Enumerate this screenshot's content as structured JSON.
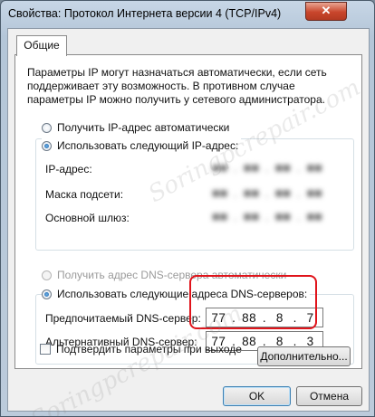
{
  "window": {
    "title": "Свойства: Протокол Интернета версии 4 (TCP/IPv4)",
    "close_label": "✕"
  },
  "tabs": [
    {
      "label": "Общие"
    }
  ],
  "description": "Параметры IP могут назначаться автоматически, если сеть поддерживает эту возможность. В противном случае параметры IP можно получить у сетевого администратора.",
  "ip_section": {
    "auto_label": "Получить IP-адрес автоматически",
    "manual_label": "Использовать следующий IP-адрес:",
    "selected": "manual",
    "fields": [
      {
        "label": "IP-адрес:",
        "octets": [
          "",
          "",
          "",
          ""
        ]
      },
      {
        "label": "Маска подсети:",
        "octets": [
          "",
          "",
          "",
          ""
        ]
      },
      {
        "label": "Основной шлюз:",
        "octets": [
          "",
          "",
          "",
          ""
        ]
      }
    ]
  },
  "dns_section": {
    "auto_label": "Получить адрес DNS-сервера автоматически",
    "manual_label": "Использовать следующие адреса DNS-серверов:",
    "selected": "manual",
    "preferred_label": "Предпочитаемый DNS-сервер:",
    "preferred_octets": [
      "77",
      "88",
      "8",
      "7"
    ],
    "alternate_label": "Альтернативный DNS-сервер:",
    "alternate_octets": [
      "77",
      "88",
      "8",
      "3"
    ]
  },
  "validate_checkbox": {
    "label": "Подтвердить параметры при выходе",
    "checked": false
  },
  "buttons": {
    "advanced": "Дополнительно...",
    "ok": "OK",
    "cancel": "Отмена"
  },
  "watermark": "Soringpcrepair.com",
  "colors": {
    "highlight": "#e0141b",
    "radio_selected": "#1b5fa8"
  }
}
